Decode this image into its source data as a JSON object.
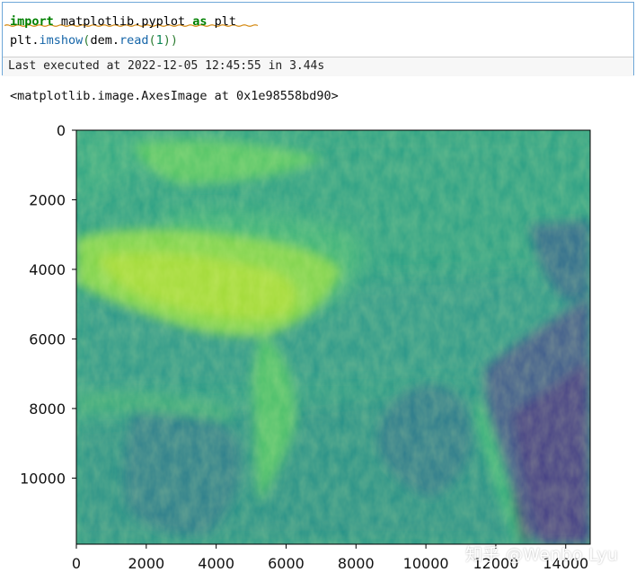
{
  "cell": {
    "line1": {
      "import_kw": "import",
      "module": " matplotlib.pyplot ",
      "as_kw": "as",
      "alias": " plt"
    },
    "line2": {
      "obj": "plt.",
      "fn": "imshow",
      "p1": "(",
      "arg_obj": "dem.",
      "arg_fn": "read",
      "p2": "(",
      "num": "1",
      "p3": "))"
    },
    "status": "Last executed at 2022-12-05 12:45:55 in 3.44s"
  },
  "output": {
    "repr": "<matplotlib.image.AxesImage at 0x1e98558bd90>"
  },
  "chart_data": {
    "type": "heatmap",
    "colormap": "viridis",
    "x_ticks": [
      0,
      2000,
      4000,
      6000,
      8000,
      10000,
      12000,
      14000
    ],
    "y_ticks": [
      0,
      2000,
      4000,
      6000,
      8000,
      10000
    ],
    "xlim": [
      0,
      14700
    ],
    "ylim": [
      11900,
      0
    ],
    "x_tick_labels": [
      "0",
      "2000",
      "4000",
      "6000",
      "8000",
      "10000",
      "12000",
      "14000"
    ],
    "y_tick_labels": [
      "0",
      "2000",
      "4000",
      "6000",
      "8000",
      "10000"
    ]
  },
  "watermark": "知乎 @Wenbo Lyu",
  "colors": {
    "cell_border": "#6ea7d8",
    "keyword": "#008000",
    "function": "#1565a8"
  }
}
